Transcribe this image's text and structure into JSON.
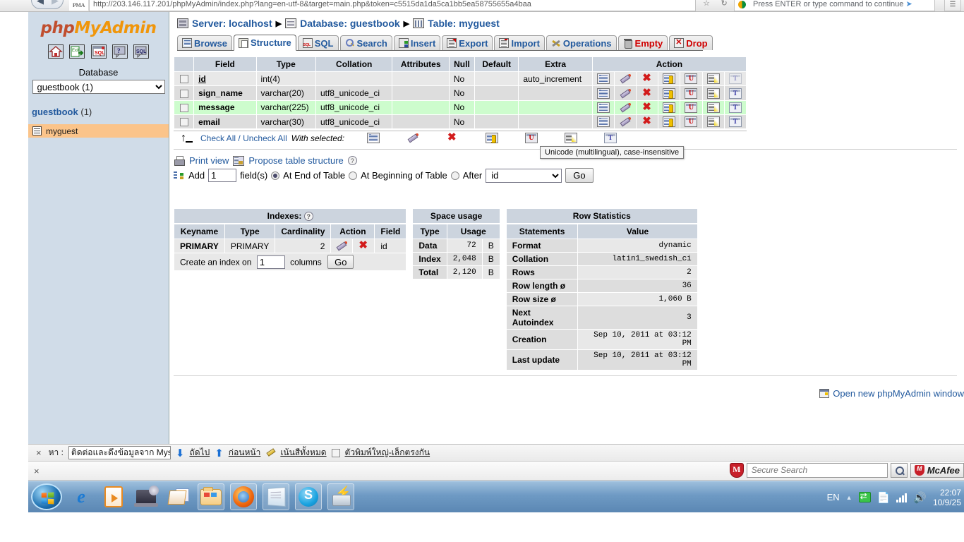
{
  "browser": {
    "back_icon": "back-arrow",
    "forward_icon": "forward-arrow",
    "favicon_label": "PMA",
    "url": "http://203.146.117.201/phpMyAdmin/index.php?lang=en-utf-8&target=main.php&token=c5515da1da5ca1bb5ea58755655a4baa",
    "omnibox2_text": "Press ENTER or type command to continue",
    "bookmark_icon": "bookmark-icon",
    "reload_icon": "reload-icon",
    "menu_icon": "menu-icon"
  },
  "sidebar": {
    "logo": {
      "php": "php",
      "my": "My",
      "admin": "Admin"
    },
    "quick_icons": [
      {
        "name": "home-icon",
        "label": "Home"
      },
      {
        "name": "exit-icon",
        "label": "Log out"
      },
      {
        "name": "sql-query-icon",
        "label": "Query window"
      },
      {
        "name": "help-icon",
        "label": "phpMyAdmin documentation"
      },
      {
        "name": "sql-help-icon",
        "label": "MySQL documentation"
      }
    ],
    "database_label": "Database",
    "database_select_value": "guestbook (1)",
    "database_options": [
      "guestbook (1)"
    ],
    "current_db_name": "guestbook",
    "current_db_count": "(1)",
    "tables": [
      {
        "name": "myguest",
        "icon": "table-icon",
        "selected": true
      }
    ]
  },
  "breadcrumb": {
    "server_icon": "server-icon",
    "server": "Server: localhost",
    "db_icon": "database-icon",
    "database": "Database: guestbook",
    "table_icon": "table-icon",
    "table": "Table: myguest",
    "separator": "▶"
  },
  "tabs": [
    {
      "label": "Browse",
      "icon": "browse-icon",
      "active": false,
      "danger": false
    },
    {
      "label": "Structure",
      "icon": "structure-icon",
      "active": true,
      "danger": false
    },
    {
      "label": "SQL",
      "icon": "sql-icon",
      "active": false,
      "danger": false
    },
    {
      "label": "Search",
      "icon": "search-icon",
      "active": false,
      "danger": false
    },
    {
      "label": "Insert",
      "icon": "insert-icon",
      "active": false,
      "danger": false
    },
    {
      "label": "Export",
      "icon": "export-icon",
      "active": false,
      "danger": false
    },
    {
      "label": "Import",
      "icon": "import-icon",
      "active": false,
      "danger": false
    },
    {
      "label": "Operations",
      "icon": "operations-icon",
      "active": false,
      "danger": false
    },
    {
      "label": "Empty",
      "icon": "empty-icon",
      "active": false,
      "danger": true
    },
    {
      "label": "Drop",
      "icon": "drop-icon",
      "active": false,
      "danger": true
    }
  ],
  "structure": {
    "headers": [
      "",
      "Field",
      "Type",
      "Collation",
      "Attributes",
      "Null",
      "Default",
      "Extra",
      "Action"
    ],
    "action_icons": [
      "browse-distinct-icon",
      "change-icon",
      "drop-icon",
      "primary-key-icon",
      "unique-icon",
      "index-icon",
      "fulltext-icon"
    ],
    "rows": [
      {
        "field": "id",
        "type": "int(4)",
        "collation": "",
        "attributes": "",
        "null": "No",
        "default": "",
        "extra": "auto_increment",
        "primary": true,
        "highlight": false,
        "fulltext_dim": true
      },
      {
        "field": "sign_name",
        "type": "varchar(20)",
        "collation": "utf8_unicode_ci",
        "attributes": "",
        "null": "No",
        "default": "",
        "extra": "",
        "primary": false,
        "highlight": false,
        "fulltext_dim": false
      },
      {
        "field": "message",
        "type": "varchar(225)",
        "collation": "utf8_unicode_ci",
        "attributes": "",
        "null": "No",
        "default": "",
        "extra": "",
        "primary": false,
        "highlight": true,
        "fulltext_dim": false
      },
      {
        "field": "email",
        "type": "varchar(30)",
        "collation": "utf8_unicode_ci",
        "attributes": "",
        "null": "No",
        "default": "",
        "extra": "",
        "primary": false,
        "highlight": false,
        "fulltext_dim": false
      }
    ],
    "check_all": "Check All",
    "slash": "/",
    "uncheck_all": "Uncheck All",
    "with_selected": "With selected:"
  },
  "tooltip": {
    "text": "Unicode (multilingual), case-insensitive"
  },
  "actions_bar": {
    "print_view": "Print view",
    "propose_structure": "Propose table structure",
    "help_marker": "?",
    "add_label": "Add",
    "add_count": "1",
    "fields_label": "field(s)",
    "at_end": "At End of Table",
    "at_beginning": "At Beginning of Table",
    "after": "After",
    "after_select_value": "id",
    "after_options": [
      "id",
      "sign_name",
      "message",
      "email"
    ],
    "go": "Go",
    "selected_position": "at_end"
  },
  "indexes": {
    "caption": "Indexes:",
    "help_marker": "?",
    "headers": [
      "Keyname",
      "Type",
      "Cardinality",
      "Action",
      "Field"
    ],
    "rows": [
      {
        "keyname": "PRIMARY",
        "type": "PRIMARY",
        "cardinality": "2",
        "field": "id",
        "action_icons": [
          "edit-index-icon",
          "drop-index-icon"
        ]
      }
    ],
    "create_prefix": "Create an index on",
    "create_columns_value": "1",
    "create_suffix": "columns",
    "go": "Go"
  },
  "space_usage": {
    "caption": "Space usage",
    "headers": [
      "Type",
      "Usage"
    ],
    "rows": [
      {
        "type": "Data",
        "usage": "72",
        "unit": "B"
      },
      {
        "type": "Index",
        "usage": "2,048",
        "unit": "B"
      },
      {
        "type": "Total",
        "usage": "2,120",
        "unit": "B"
      }
    ]
  },
  "row_statistics": {
    "caption": "Row Statistics",
    "headers": [
      "Statements",
      "Value"
    ],
    "rows": [
      {
        "label": "Format",
        "value": "dynamic"
      },
      {
        "label": "Collation",
        "value": "latin1_swedish_ci"
      },
      {
        "label": "Rows",
        "value": "2"
      },
      {
        "label": "Row length ø",
        "value": "36"
      },
      {
        "label": "Row size ø",
        "value": "1,060 B"
      },
      {
        "label": "Next Autoindex",
        "value": "3"
      },
      {
        "label": "Creation",
        "value": "Sep 10, 2011 at 03:12 PM"
      },
      {
        "label": "Last update",
        "value": "Sep 10, 2011 at 03:12 PM"
      }
    ]
  },
  "new_window_link": {
    "icon": "new-window-icon",
    "label": "Open new phpMyAdmin window"
  },
  "find_bar": {
    "close": "×",
    "find_label": "หา :",
    "query": "ติดต่อและดึงข้อมูลจาก Mysq",
    "next": "ถัดไป",
    "previous": "ก่อนหน้า",
    "highlight_all": "เน้นสีทั้งหมด",
    "match_case": "ตัวพิมพ์ใหญ่-เล็กตรงกัน"
  },
  "mcafee_bar": {
    "close": "×",
    "shield_icon": "mcafee-shield-icon",
    "search_placeholder": "Secure Search",
    "search_value": "",
    "go_icon": "search-icon",
    "brand": "McAfee"
  },
  "taskbar": {
    "start": "start-orb",
    "items": [
      {
        "name": "internet-explorer-icon",
        "pinned": false
      },
      {
        "name": "windows-media-player-icon",
        "pinned": false
      },
      {
        "name": "computer-icon",
        "pinned": false
      },
      {
        "name": "windows-live-mail-icon",
        "pinned": false
      },
      {
        "name": "windows-explorer-icon",
        "pinned": true
      },
      {
        "name": "firefox-icon",
        "pinned": true
      },
      {
        "name": "notepad-icon",
        "pinned": true
      },
      {
        "name": "skype-icon",
        "pinned": true
      },
      {
        "name": "remote-desktop-icon",
        "pinned": true
      }
    ],
    "tray": {
      "language": "EN",
      "show_hidden_icon": "caret-up-icon",
      "network_icon": "network-icon",
      "action_center_icon": "action-center-icon",
      "signal_icon": "signal-icon",
      "volume_icon": "volume-icon",
      "time": "22:07",
      "date": "10/9/25"
    }
  },
  "colors": {
    "link": "#235a9e",
    "danger": "#d00000",
    "header_bg": "#ccd4de",
    "row_odd": "#dddddd",
    "row_even": "#e8e8e8",
    "row_highlight": "#cdfccd",
    "sidebar_bg": "#d0dce8",
    "table_selected": "#fbc48a"
  }
}
